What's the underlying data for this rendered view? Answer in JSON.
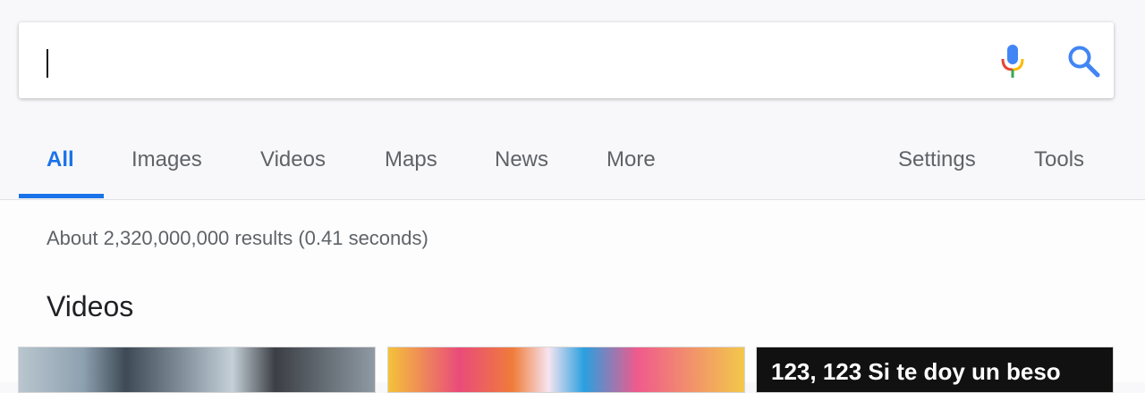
{
  "search": {
    "value": "",
    "placeholder": ""
  },
  "icons": {
    "mic": "microphone-icon",
    "search": "search-icon"
  },
  "colors": {
    "accent": "#1a73e8",
    "tab_text": "#5f6368",
    "mic_blue": "#4285f4",
    "mic_red": "#ea4335",
    "mic_yellow": "#fbbc05",
    "mic_green": "#34a853"
  },
  "tabs": {
    "all": "All",
    "images": "Images",
    "videos": "Videos",
    "maps": "Maps",
    "news": "News",
    "more": "More",
    "settings": "Settings",
    "tools": "Tools",
    "active": "All"
  },
  "results": {
    "stats": "About 2,320,000,000 results (0.41 seconds)"
  },
  "videos_section": {
    "title": "Videos",
    "cards": [
      {
        "thumbnail_text": ""
      },
      {
        "thumbnail_text": ""
      },
      {
        "thumbnail_text": "123, 123 Si te doy un beso"
      }
    ]
  }
}
